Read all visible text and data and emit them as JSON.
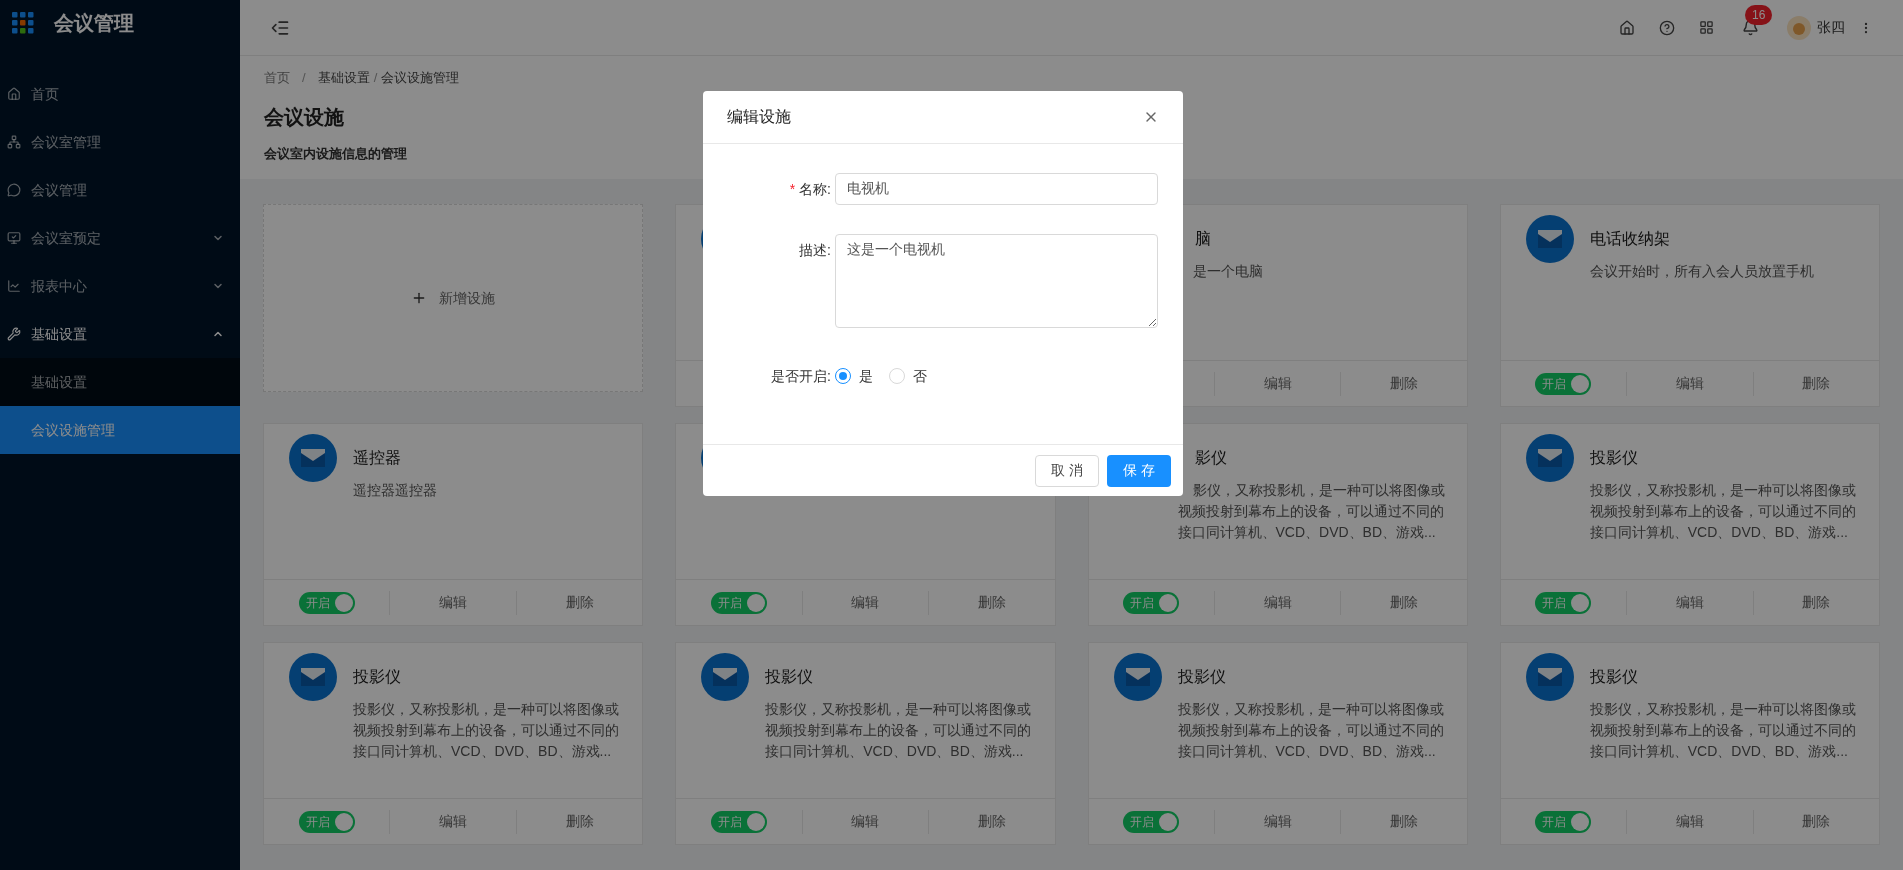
{
  "sidebar": {
    "logo": "会议管理",
    "items": [
      {
        "label": "首页",
        "selected": false
      },
      {
        "label": "会议室管理",
        "selected": false
      },
      {
        "label": "会议管理",
        "selected": false
      },
      {
        "label": "会议室预定",
        "selected": false,
        "expanded": false
      },
      {
        "label": "报表中心",
        "selected": false,
        "expanded": false
      },
      {
        "label": "基础设置",
        "selected": false,
        "expanded": true,
        "children": [
          {
            "label": "基础设置",
            "selected": false
          },
          {
            "label": "会议设施管理",
            "selected": true
          }
        ]
      }
    ]
  },
  "header": {
    "notifications": "16",
    "user": "张四"
  },
  "breadcrumb": {
    "items": [
      "首页",
      "基础设置",
      "会议设施管理"
    ],
    "separator": "/"
  },
  "page": {
    "title": "会议设施",
    "subtitle": "会议室内设施信息的管理"
  },
  "cards": [
    {
      "kind": "add",
      "label": "新增设施"
    },
    {
      "kind": "facility"
    },
    {
      "kind": "facility",
      "covered": true,
      "title": "脑",
      "description": "是一个电脑",
      "actions": [
        "编辑",
        "删除"
      ]
    },
    {
      "kind": "facility",
      "title": "电话收纳架",
      "description": "会议开始时，所有入会人员放置手机",
      "on": true,
      "toggle_label": "开启",
      "actions": [
        "编辑",
        "删除"
      ]
    },
    {
      "kind": "facility",
      "title": "遥控器",
      "description": "遥控器遥控器",
      "on": true,
      "toggle_label": "开启",
      "actions": [
        "编辑",
        "删除"
      ]
    },
    {
      "kind": "facility",
      "on": true,
      "toggle_label": "开启",
      "actions": [
        "编辑",
        "删除"
      ]
    },
    {
      "kind": "facility",
      "covered": true,
      "title": "影仪",
      "description": "影仪，又称投影机，是一种可以将图像或视频投射到幕布上的设备，可以通过不同的接口同计算机、VCD、DVD、BD、游戏...",
      "on": true,
      "toggle_label": "开启",
      "actions": [
        "编辑",
        "删除"
      ]
    },
    {
      "kind": "facility",
      "title": "投影仪",
      "description": "投影仪，又称投影机，是一种可以将图像或视频投射到幕布上的设备，可以通过不同的接口同计算机、VCD、DVD、BD、游戏...",
      "on": true,
      "toggle_label": "开启",
      "actions": [
        "编辑",
        "删除"
      ]
    },
    {
      "kind": "facility",
      "title": "投影仪",
      "description": "投影仪，又称投影机，是一种可以将图像或视频投射到幕布上的设备，可以通过不同的接口同计算机、VCD、DVD、BD、游戏...",
      "on": true,
      "toggle_label": "开启",
      "actions": [
        "编辑",
        "删除"
      ]
    },
    {
      "kind": "facility",
      "title": "投影仪",
      "description": "投影仪，又称投影机，是一种可以将图像或视频投射到幕布上的设备，可以通过不同的接口同计算机、VCD、DVD、BD、游戏...",
      "on": true,
      "toggle_label": "开启",
      "actions": [
        "编辑",
        "删除"
      ]
    },
    {
      "kind": "facility",
      "title": "投影仪",
      "description": "投影仪，又称投影机，是一种可以将图像或视频投射到幕布上的设备，可以通过不同的接口同计算机、VCD、DVD、BD、游戏...",
      "on": true,
      "toggle_label": "开启",
      "actions": [
        "编辑",
        "删除"
      ]
    },
    {
      "kind": "facility",
      "title": "投影仪",
      "description": "投影仪，又称投影机，是一种可以将图像或视频投射到幕布上的设备，可以通过不同的接口同计算机、VCD、DVD、BD、游戏...",
      "on": true,
      "toggle_label": "开启",
      "actions": [
        "编辑",
        "删除"
      ]
    }
  ],
  "modal": {
    "title": "编辑设施",
    "fields": [
      {
        "kind": "text",
        "label": "名称:",
        "required_mark": "*",
        "value": "电视机"
      },
      {
        "kind": "textarea",
        "label": "描述:",
        "value": "这是一个电视机"
      },
      {
        "kind": "radio",
        "label": "是否开启:",
        "options": [
          {
            "label": "是",
            "selected": true
          },
          {
            "label": "否",
            "selected": false
          }
        ]
      }
    ],
    "buttons": [
      {
        "label": "取 消",
        "primary": false
      },
      {
        "label": "保 存",
        "primary": true
      }
    ]
  }
}
